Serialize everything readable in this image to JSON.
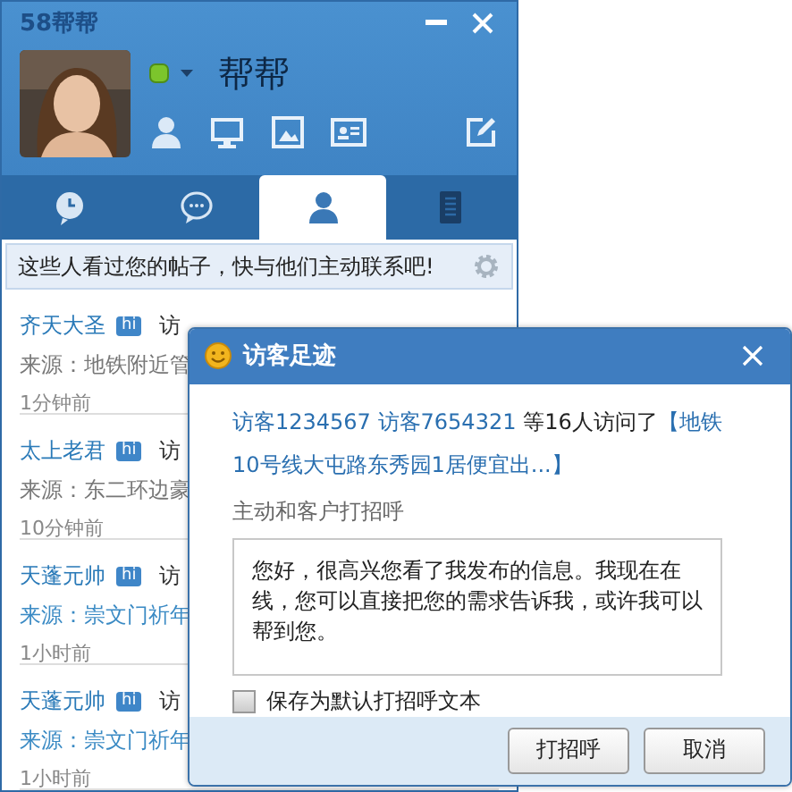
{
  "window": {
    "title": "58帮帮"
  },
  "profile": {
    "name": "帮帮"
  },
  "tabs": [
    {
      "kind": "clock",
      "selected": false
    },
    {
      "kind": "chat",
      "selected": false
    },
    {
      "kind": "person",
      "selected": true
    },
    {
      "kind": "list",
      "selected": false
    }
  ],
  "notice": "这些人看过您的帖子，快与他们主动联系吧!",
  "visitors": [
    {
      "name": "齐天大圣",
      "badge": "hi",
      "action": "访",
      "source": "来源：地铁附近管",
      "source_linked": false,
      "time": "1分钟前"
    },
    {
      "name": "太上老君",
      "badge": "hi",
      "action": "访",
      "source": "来源：东二环边豪",
      "source_linked": false,
      "time": "10分钟前"
    },
    {
      "name": "天蓬元帅",
      "badge": "hi",
      "action": "访",
      "source": "来源：崇文门祈年",
      "source_linked": true,
      "time": "1小时前"
    },
    {
      "name": "天蓬元帅",
      "badge": "hi",
      "action": "访",
      "source": "来源：崇文门祈年",
      "source_linked": true,
      "time": "1小时前"
    }
  ],
  "dialog": {
    "title": "访客足迹",
    "visitors": [
      "访客1234567",
      "访客7654321"
    ],
    "summary": "等16人访问了",
    "post": "【地铁10号线大屯路东秀园1居便宜出...】",
    "greeting_label": "主动和客户打招呼",
    "greeting": "您好，很高兴您看了我发布的信息。我现在在线，您可以直接把您的需求告诉我，或许我可以帮到您。",
    "save_default": {
      "label": "保存为默认打招呼文本",
      "checked": false
    },
    "buttons": [
      "打招呼",
      "取消"
    ]
  }
}
